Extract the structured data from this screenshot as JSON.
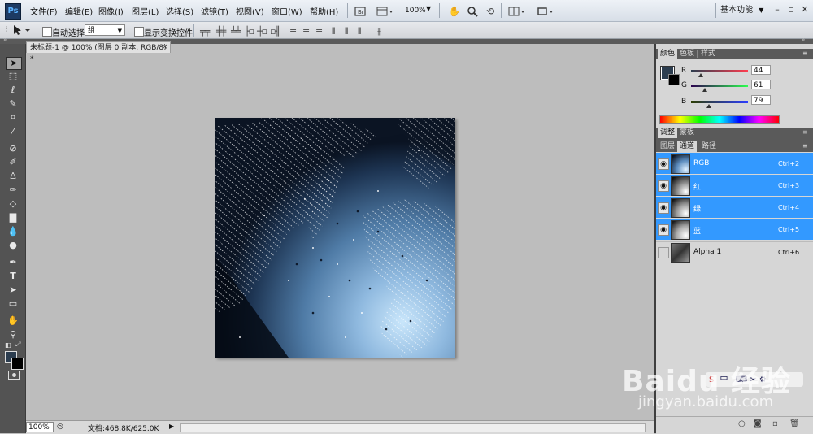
{
  "menubar": {
    "logo": "Ps",
    "items": [
      "文件(F)",
      "编辑(E)",
      "图像(I)",
      "图层(L)",
      "选择(S)",
      "滤镜(T)",
      "视图(V)",
      "窗口(W)",
      "帮助(H)"
    ],
    "zoom": "100%",
    "workspace": "基本功能"
  },
  "options": {
    "auto_select_label": "自动选择:",
    "auto_select_value": "组",
    "show_transform_label": "显示变换控件"
  },
  "document": {
    "tab_title": "未标题-1 @ 100% (图层 0 副本, RGB/8) *",
    "tab_close": "×"
  },
  "status": {
    "zoom": "100%",
    "doc_info": "文档:468.8K/625.0K"
  },
  "color_panel": {
    "tabs": [
      "颜色",
      "色板",
      "样式"
    ],
    "fg_color": "#2c3d4f",
    "bg_color": "#000000",
    "r_label": "R",
    "r_value": "44",
    "g_label": "G",
    "g_value": "61",
    "b_label": "B",
    "b_value": "79",
    "r_level": 0.17,
    "g_level": 0.24,
    "b_level": 0.31
  },
  "adjust_panel": {
    "tabs": [
      "调整",
      "蒙板"
    ]
  },
  "channels_panel": {
    "tabs": [
      "图层",
      "通道",
      "路径"
    ],
    "channels": [
      {
        "name": "RGB",
        "shortcut": "Ctrl+2",
        "selected": true
      },
      {
        "name": "红",
        "shortcut": "Ctrl+3",
        "selected": true
      },
      {
        "name": "绿",
        "shortcut": "Ctrl+4",
        "selected": true
      },
      {
        "name": "蓝",
        "shortcut": "Ctrl+5",
        "selected": true
      },
      {
        "name": "Alpha 1",
        "shortcut": "Ctrl+6",
        "selected": false
      }
    ]
  },
  "watermark": {
    "logo": "Baidu 经验",
    "site": "jingyan.baidu.com"
  }
}
